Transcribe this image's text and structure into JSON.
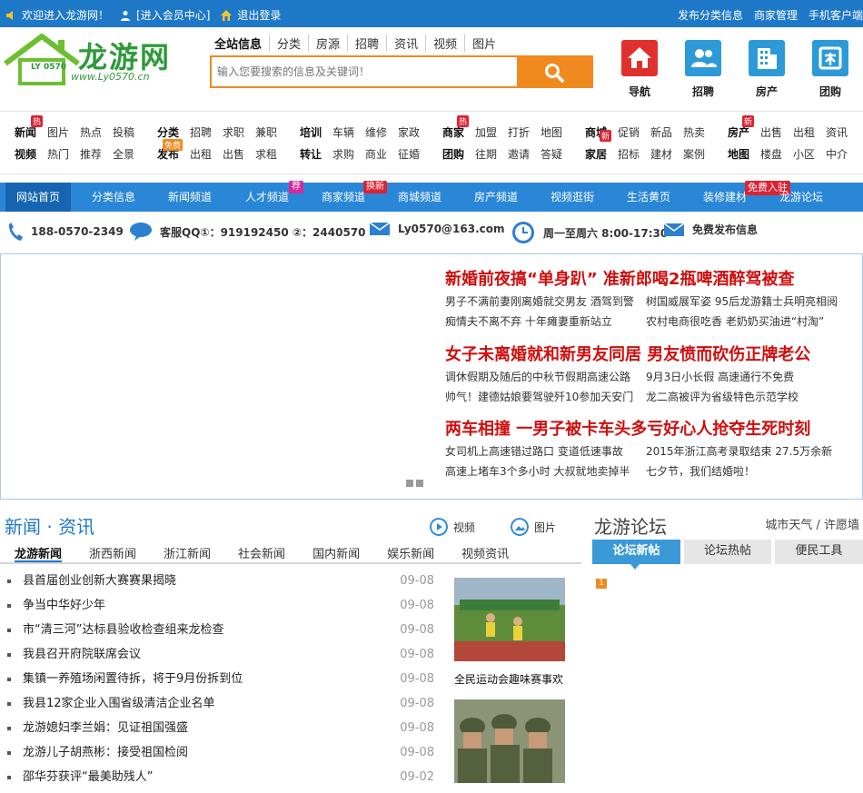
{
  "topbar": {
    "welcome": "欢迎进入龙游网！",
    "member_center": "[进入会员中心]",
    "logout": "退出登录",
    "right_links": [
      "发布分类信息",
      "商家管理",
      "手机客户端"
    ]
  },
  "logo": {
    "name": "龙游网",
    "badge": "LY 0570",
    "url": "www.Ly0570.cn"
  },
  "search": {
    "tabs": [
      "全站信息",
      "分类",
      "房源",
      "招聘",
      "资讯",
      "视频",
      "图片"
    ],
    "placeholder": "输入您要搜索的信息及关键词！"
  },
  "header_icons": [
    {
      "label": "导航",
      "color": "#e0302e",
      "icon": "home-icon"
    },
    {
      "label": "招聘",
      "color": "#2d9ad8",
      "icon": "people-icon"
    },
    {
      "label": "房产",
      "color": "#2d9ad8",
      "icon": "building-icon"
    },
    {
      "label": "团购",
      "color": "#2d9ad8",
      "icon": "coupon-icon"
    }
  ],
  "categories": [
    {
      "rows": [
        [
          "新闻",
          "图片",
          "热点",
          "投稿"
        ],
        [
          "视频",
          "热门",
          "推荐",
          "全景"
        ]
      ],
      "badge": "热"
    },
    {
      "rows": [
        [
          "分类",
          "招聘",
          "求职",
          "兼职"
        ],
        [
          "发布",
          "出租",
          "出售",
          "求租"
        ]
      ],
      "badge": "免费"
    },
    {
      "rows": [
        [
          "培训",
          "车辆",
          "维修",
          "家政"
        ],
        [
          "转让",
          "求购",
          "商业",
          "征婚"
        ]
      ],
      "badge": ""
    },
    {
      "rows": [
        [
          "商家",
          "加盟",
          "打折",
          "地图"
        ],
        [
          "团购",
          "往期",
          "邀请",
          "答疑"
        ]
      ],
      "badge": "热"
    },
    {
      "rows": [
        [
          "商城",
          "促销",
          "新品",
          "热卖"
        ],
        [
          "家居",
          "招标",
          "建材",
          "案例"
        ]
      ],
      "badge": "新"
    },
    {
      "rows": [
        [
          "房产",
          "出售",
          "出租",
          "资讯"
        ],
        [
          "地图",
          "楼盘",
          "小区",
          "中介"
        ]
      ],
      "badge": "新"
    }
  ],
  "mainnav": {
    "items": [
      "网站首页",
      "分类信息",
      "新闻频道",
      "人才频道",
      "商家频道",
      "商城频道",
      "房产频道",
      "视频逛街",
      "生活黄页",
      "装修建材",
      "龙游论坛"
    ],
    "tags": {
      "hot": "荐",
      "new": "换新",
      "free": "免费入驻"
    }
  },
  "contact": {
    "phone": "188-0570-2349",
    "qq": "客服QQ①：919192450 ②：2440570",
    "email": "Ly0570@163.com",
    "hours": "周一至周六 8:00-17:30",
    "publish": "免费发布信息"
  },
  "headlines": [
    {
      "title": "新婚前夜搞“单身趴” 准新郎喝2瓶啤酒醉驾被查",
      "subs": [
        "男子不满前妻刚离婚就交男友 酒驾到警",
        "树国威展军姿 95后龙游籍士兵明亮相阅",
        "痴情夫不离不弃  十年瘫妻重新站立",
        "农村电商很吃香 老奶奶买油进“村淘”"
      ]
    },
    {
      "title": "女子未离婚就和新男友同居 男友愤而砍伤正牌老公",
      "subs": [
        "调休假期及随后的中秋节假期高速公路",
        "9月3日小长假 高速通行不免费",
        "帅气！建德姑娘要驾驶歼10参加天安门",
        "龙二高被评为省级特色示范学校"
      ]
    },
    {
      "title": "两车相撞 一男子被卡车头多亏好心人抢夺生死时刻",
      "subs": [
        "女司机上高速错过路口 变道低速事故",
        "2015年浙江高考录取结束 27.5万余新",
        "高速上堵车3个多小时 大叔就地卖掉半",
        "七夕节，我们结婚啦！"
      ]
    }
  ],
  "news": {
    "title": "新闻 · 资讯",
    "video_label": "视频",
    "photo_label": "图片",
    "tabs": [
      "龙游新闻",
      "浙西新闻",
      "浙江新闻",
      "社会新闻",
      "国内新闻",
      "娱乐新闻",
      "视频资讯"
    ],
    "items": [
      {
        "title": "县首届创业创新大赛赛果揭晓",
        "date": "09-08"
      },
      {
        "title": "争当中华好少年",
        "date": "09-08"
      },
      {
        "title": "市“清三河”达标县验收检查组来龙检查",
        "date": "09-08"
      },
      {
        "title": "我县召开府院联席会议",
        "date": "09-08"
      },
      {
        "title": "集镇一养殖场闲置待拆，将于9月份拆到位",
        "date": "09-08"
      },
      {
        "title": "我县12家企业入围省级清洁企业名单",
        "date": "09-08"
      },
      {
        "title": "龙游媳妇李兰娟：见证祖国强盛",
        "date": "09-08"
      },
      {
        "title": "龙游儿子胡燕彬：接受祖国检阅",
        "date": "09-08"
      },
      {
        "title": "邵华芬获评“最美助残人”",
        "date": "09-02"
      }
    ],
    "pics": [
      {
        "caption": "全民运动会趣味赛事欢"
      },
      {
        "caption": ""
      }
    ]
  },
  "forum": {
    "title": "龙游论坛",
    "links": "城市天气 / 许愿墙",
    "tabs": [
      "论坛新帖",
      "论坛热帖",
      "便民工具"
    ],
    "first_num": "1"
  }
}
